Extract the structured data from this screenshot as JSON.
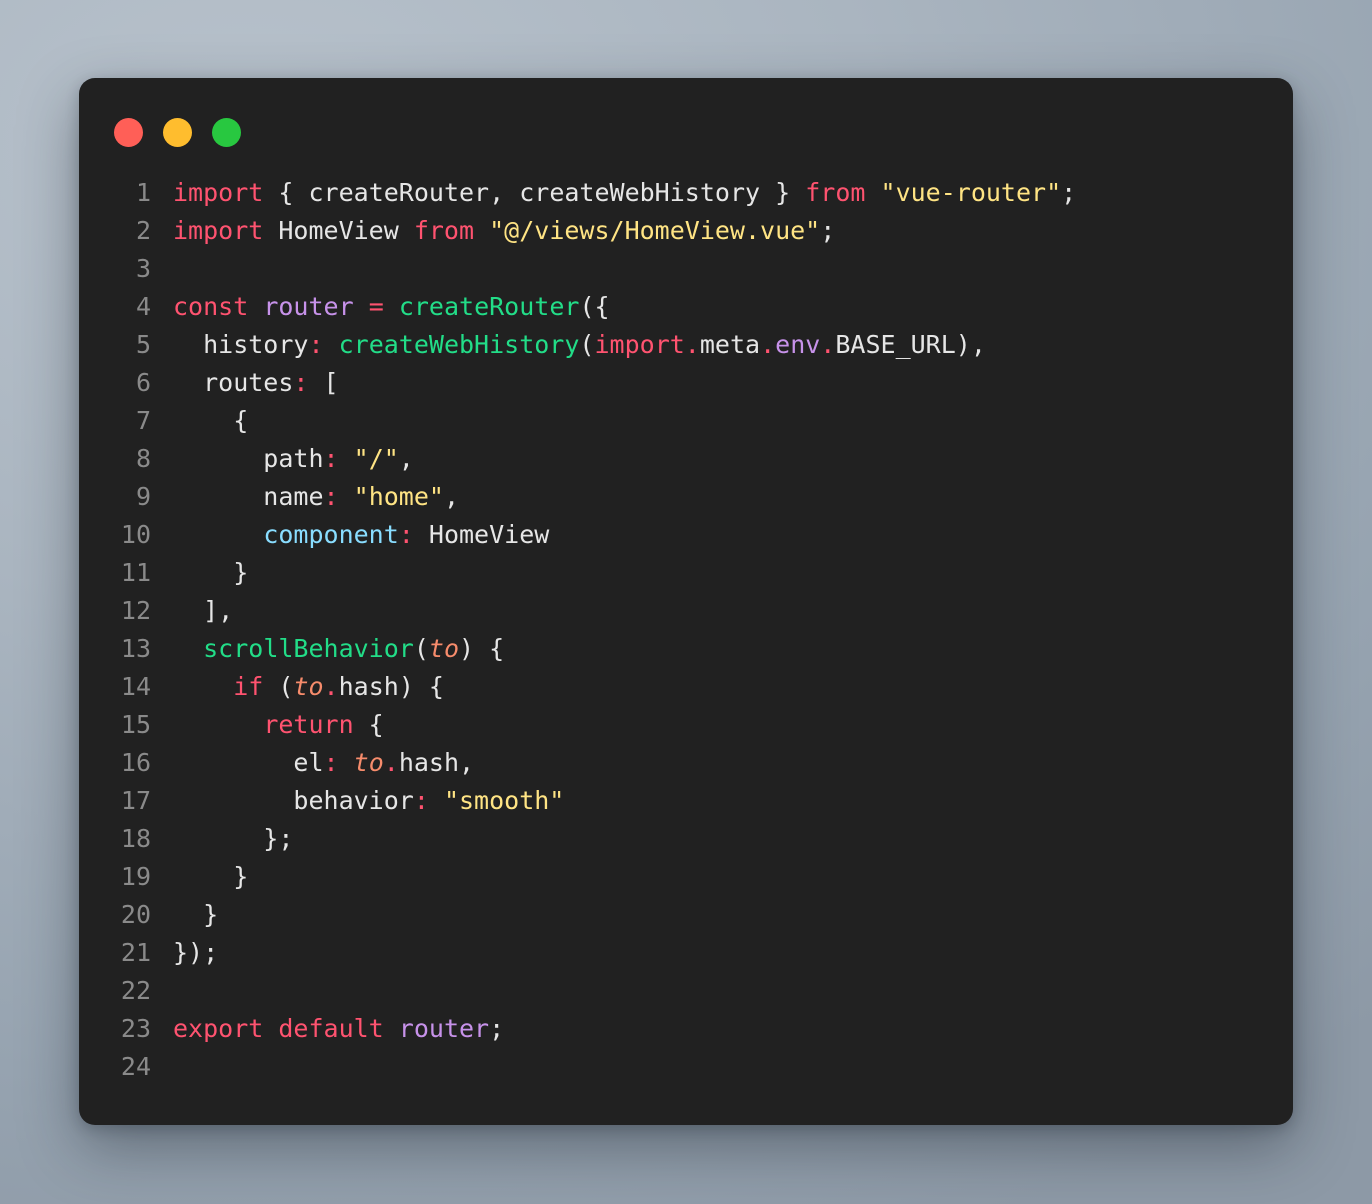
{
  "window": {
    "title": "",
    "background_color": "#212121",
    "accent_colors": {
      "traffic_red": "#ff5f57",
      "traffic_yellow": "#ffbd2e",
      "traffic_green": "#28c840",
      "keyword": "#ff5370",
      "function": "#22dd88",
      "string": "#ffe484",
      "variable": "#c792ea",
      "property": "#89ddff",
      "parameter": "#f78c6c",
      "plain": "#e6e6e6",
      "line_number": "#8a8a8a"
    },
    "traffic_lights": [
      {
        "name": "close",
        "label": ""
      },
      {
        "name": "minimize",
        "label": ""
      },
      {
        "name": "maximize",
        "label": ""
      }
    ]
  },
  "editor": {
    "language": "javascript",
    "total_lines": 24,
    "lines": [
      {
        "number": "1",
        "tokens": [
          {
            "text": "import",
            "type": "kw"
          },
          {
            "text": " ",
            "type": "plain"
          },
          {
            "text": "{",
            "type": "punc"
          },
          {
            "text": " createRouter",
            "type": "plain"
          },
          {
            "text": ",",
            "type": "punc"
          },
          {
            "text": " createWebHistory ",
            "type": "plain"
          },
          {
            "text": "}",
            "type": "punc"
          },
          {
            "text": " ",
            "type": "plain"
          },
          {
            "text": "from",
            "type": "kw"
          },
          {
            "text": " ",
            "type": "plain"
          },
          {
            "text": "\"vue-router\"",
            "type": "str"
          },
          {
            "text": ";",
            "type": "punc"
          }
        ]
      },
      {
        "number": "2",
        "tokens": [
          {
            "text": "import",
            "type": "kw"
          },
          {
            "text": " HomeView ",
            "type": "plain"
          },
          {
            "text": "from",
            "type": "kw"
          },
          {
            "text": " ",
            "type": "plain"
          },
          {
            "text": "\"@/views/HomeView.vue\"",
            "type": "str"
          },
          {
            "text": ";",
            "type": "punc"
          }
        ]
      },
      {
        "number": "3",
        "tokens": []
      },
      {
        "number": "4",
        "tokens": [
          {
            "text": "const",
            "type": "kw"
          },
          {
            "text": " ",
            "type": "plain"
          },
          {
            "text": "router",
            "type": "var"
          },
          {
            "text": " ",
            "type": "plain"
          },
          {
            "text": "=",
            "type": "op"
          },
          {
            "text": " ",
            "type": "plain"
          },
          {
            "text": "createRouter",
            "type": "fn"
          },
          {
            "text": "({",
            "type": "punc"
          }
        ]
      },
      {
        "number": "5",
        "tokens": [
          {
            "text": "  history",
            "type": "plain"
          },
          {
            "text": ":",
            "type": "op"
          },
          {
            "text": " ",
            "type": "plain"
          },
          {
            "text": "createWebHistory",
            "type": "fn"
          },
          {
            "text": "(",
            "type": "punc"
          },
          {
            "text": "import",
            "type": "kw"
          },
          {
            "text": ".",
            "type": "op"
          },
          {
            "text": "meta",
            "type": "plain"
          },
          {
            "text": ".",
            "type": "op"
          },
          {
            "text": "env",
            "type": "var"
          },
          {
            "text": ".",
            "type": "op"
          },
          {
            "text": "BASE_URL",
            "type": "plain"
          },
          {
            "text": "),",
            "type": "punc"
          }
        ]
      },
      {
        "number": "6",
        "tokens": [
          {
            "text": "  routes",
            "type": "plain"
          },
          {
            "text": ":",
            "type": "op"
          },
          {
            "text": " ",
            "type": "plain"
          },
          {
            "text": "[",
            "type": "punc"
          }
        ]
      },
      {
        "number": "7",
        "tokens": [
          {
            "text": "    {",
            "type": "punc"
          }
        ]
      },
      {
        "number": "8",
        "tokens": [
          {
            "text": "      path",
            "type": "plain"
          },
          {
            "text": ":",
            "type": "op"
          },
          {
            "text": " ",
            "type": "plain"
          },
          {
            "text": "\"/\"",
            "type": "str"
          },
          {
            "text": ",",
            "type": "punc"
          }
        ]
      },
      {
        "number": "9",
        "tokens": [
          {
            "text": "      name",
            "type": "plain"
          },
          {
            "text": ":",
            "type": "op"
          },
          {
            "text": " ",
            "type": "plain"
          },
          {
            "text": "\"home\"",
            "type": "str"
          },
          {
            "text": ",",
            "type": "punc"
          }
        ]
      },
      {
        "number": "10",
        "tokens": [
          {
            "text": "      ",
            "type": "plain"
          },
          {
            "text": "component",
            "type": "prop"
          },
          {
            "text": ":",
            "type": "op"
          },
          {
            "text": " HomeView",
            "type": "plain"
          }
        ]
      },
      {
        "number": "11",
        "tokens": [
          {
            "text": "    }",
            "type": "punc"
          }
        ]
      },
      {
        "number": "12",
        "tokens": [
          {
            "text": "  ],",
            "type": "punc"
          }
        ]
      },
      {
        "number": "13",
        "tokens": [
          {
            "text": "  ",
            "type": "plain"
          },
          {
            "text": "scrollBehavior",
            "type": "fn"
          },
          {
            "text": "(",
            "type": "punc"
          },
          {
            "text": "to",
            "type": "param"
          },
          {
            "text": ") {",
            "type": "punc"
          }
        ]
      },
      {
        "number": "14",
        "tokens": [
          {
            "text": "    ",
            "type": "plain"
          },
          {
            "text": "if",
            "type": "kw"
          },
          {
            "text": " (",
            "type": "punc"
          },
          {
            "text": "to",
            "type": "param"
          },
          {
            "text": ".",
            "type": "op"
          },
          {
            "text": "hash",
            "type": "plain"
          },
          {
            "text": ") {",
            "type": "punc"
          }
        ]
      },
      {
        "number": "15",
        "tokens": [
          {
            "text": "      ",
            "type": "plain"
          },
          {
            "text": "return",
            "type": "kw"
          },
          {
            "text": " {",
            "type": "punc"
          }
        ]
      },
      {
        "number": "16",
        "tokens": [
          {
            "text": "        el",
            "type": "plain"
          },
          {
            "text": ":",
            "type": "op"
          },
          {
            "text": " ",
            "type": "plain"
          },
          {
            "text": "to",
            "type": "param"
          },
          {
            "text": ".",
            "type": "op"
          },
          {
            "text": "hash",
            "type": "plain"
          },
          {
            "text": ",",
            "type": "punc"
          }
        ]
      },
      {
        "number": "17",
        "tokens": [
          {
            "text": "        behavior",
            "type": "plain"
          },
          {
            "text": ":",
            "type": "op"
          },
          {
            "text": " ",
            "type": "plain"
          },
          {
            "text": "\"smooth\"",
            "type": "str"
          }
        ]
      },
      {
        "number": "18",
        "tokens": [
          {
            "text": "      };",
            "type": "punc"
          }
        ]
      },
      {
        "number": "19",
        "tokens": [
          {
            "text": "    }",
            "type": "punc"
          }
        ]
      },
      {
        "number": "20",
        "tokens": [
          {
            "text": "  }",
            "type": "punc"
          }
        ]
      },
      {
        "number": "21",
        "tokens": [
          {
            "text": "});",
            "type": "punc"
          }
        ]
      },
      {
        "number": "22",
        "tokens": []
      },
      {
        "number": "23",
        "tokens": [
          {
            "text": "export",
            "type": "kw"
          },
          {
            "text": " ",
            "type": "plain"
          },
          {
            "text": "default",
            "type": "kw"
          },
          {
            "text": " ",
            "type": "plain"
          },
          {
            "text": "router",
            "type": "var"
          },
          {
            "text": ";",
            "type": "punc"
          }
        ]
      },
      {
        "number": "24",
        "tokens": []
      }
    ]
  }
}
